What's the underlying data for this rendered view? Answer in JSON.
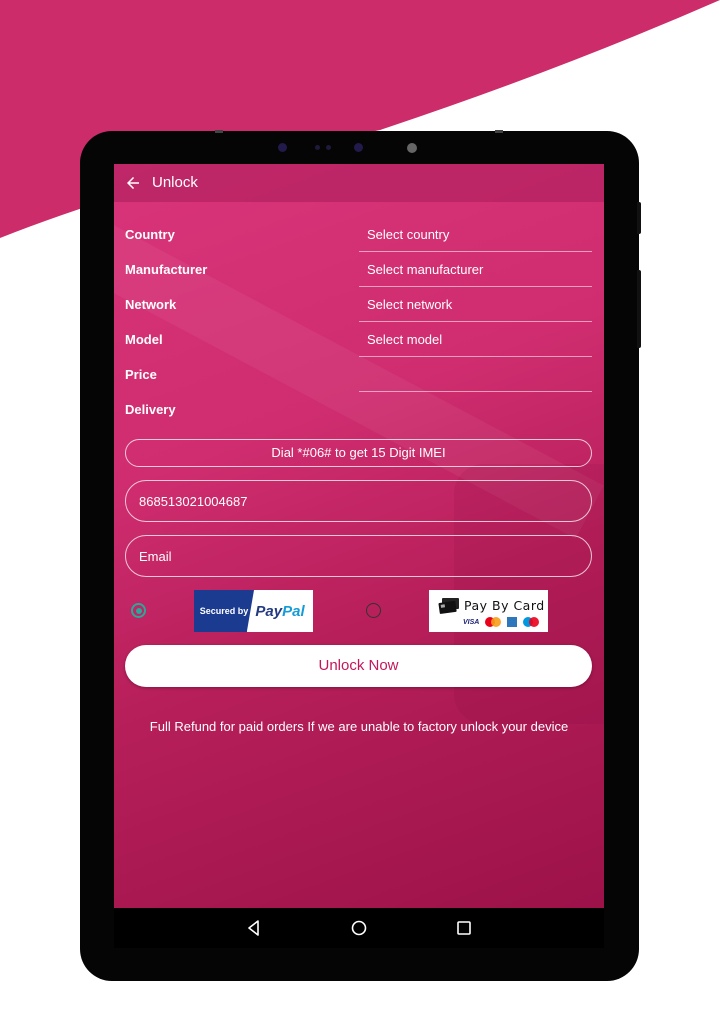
{
  "colors": {
    "brand": "#cc2c6a",
    "accent_radio": "#2aa899",
    "button_text": "#c2185b"
  },
  "appbar": {
    "back_icon": "arrow-left-icon",
    "title": "Unlock"
  },
  "form": {
    "rows": [
      {
        "label": "Country",
        "value": "Select country"
      },
      {
        "label": "Manufacturer",
        "value": "Select manufacturer"
      },
      {
        "label": "Network",
        "value": "Select network"
      },
      {
        "label": "Model",
        "value": "Select model"
      },
      {
        "label": "Price",
        "value": ""
      },
      {
        "label": "Delivery",
        "value": null
      }
    ],
    "imei_hint": "Dial *#06# to get 15 Digit IMEI",
    "imei_value": "868513021004687",
    "email_placeholder": "Email"
  },
  "payment": {
    "options": [
      {
        "name": "PayPal",
        "selected": true,
        "secured_by": "Secured by",
        "brand_pay": "Pay",
        "brand_pal": "Pal"
      },
      {
        "name": "Pay By Card",
        "selected": false,
        "title": "Pay By Card",
        "card_brands": [
          "VISA",
          "MasterCard",
          "American Express",
          "Maestro"
        ]
      }
    ]
  },
  "unlock_button": "Unlock Now",
  "refund_note": "Full Refund for paid orders If we are unable to factory unlock your device",
  "navbar": {
    "buttons": [
      "back-triangle-icon",
      "home-circle-icon",
      "recents-square-icon"
    ]
  }
}
